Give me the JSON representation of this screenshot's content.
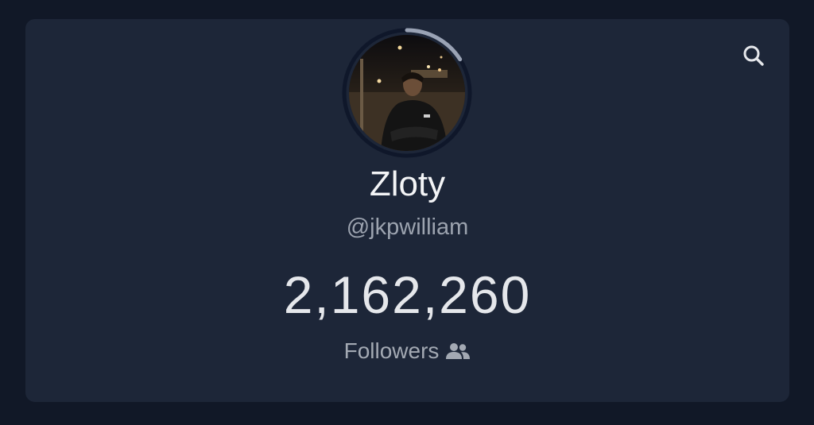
{
  "profile": {
    "display_name": "Zloty",
    "handle": "@jkpwilliam",
    "follower_count": "2,162,260",
    "followers_label": "Followers",
    "ring_progress": 0.16
  },
  "icons": {
    "search": "search-icon",
    "followers": "users-icon"
  },
  "colors": {
    "page_background": "#111827",
    "card_background": "#1d2638",
    "ring_track": "#0f172a",
    "ring_progress": "#9aa3b5",
    "text_primary": "#f3f4f6",
    "text_secondary": "#9ca3af"
  }
}
